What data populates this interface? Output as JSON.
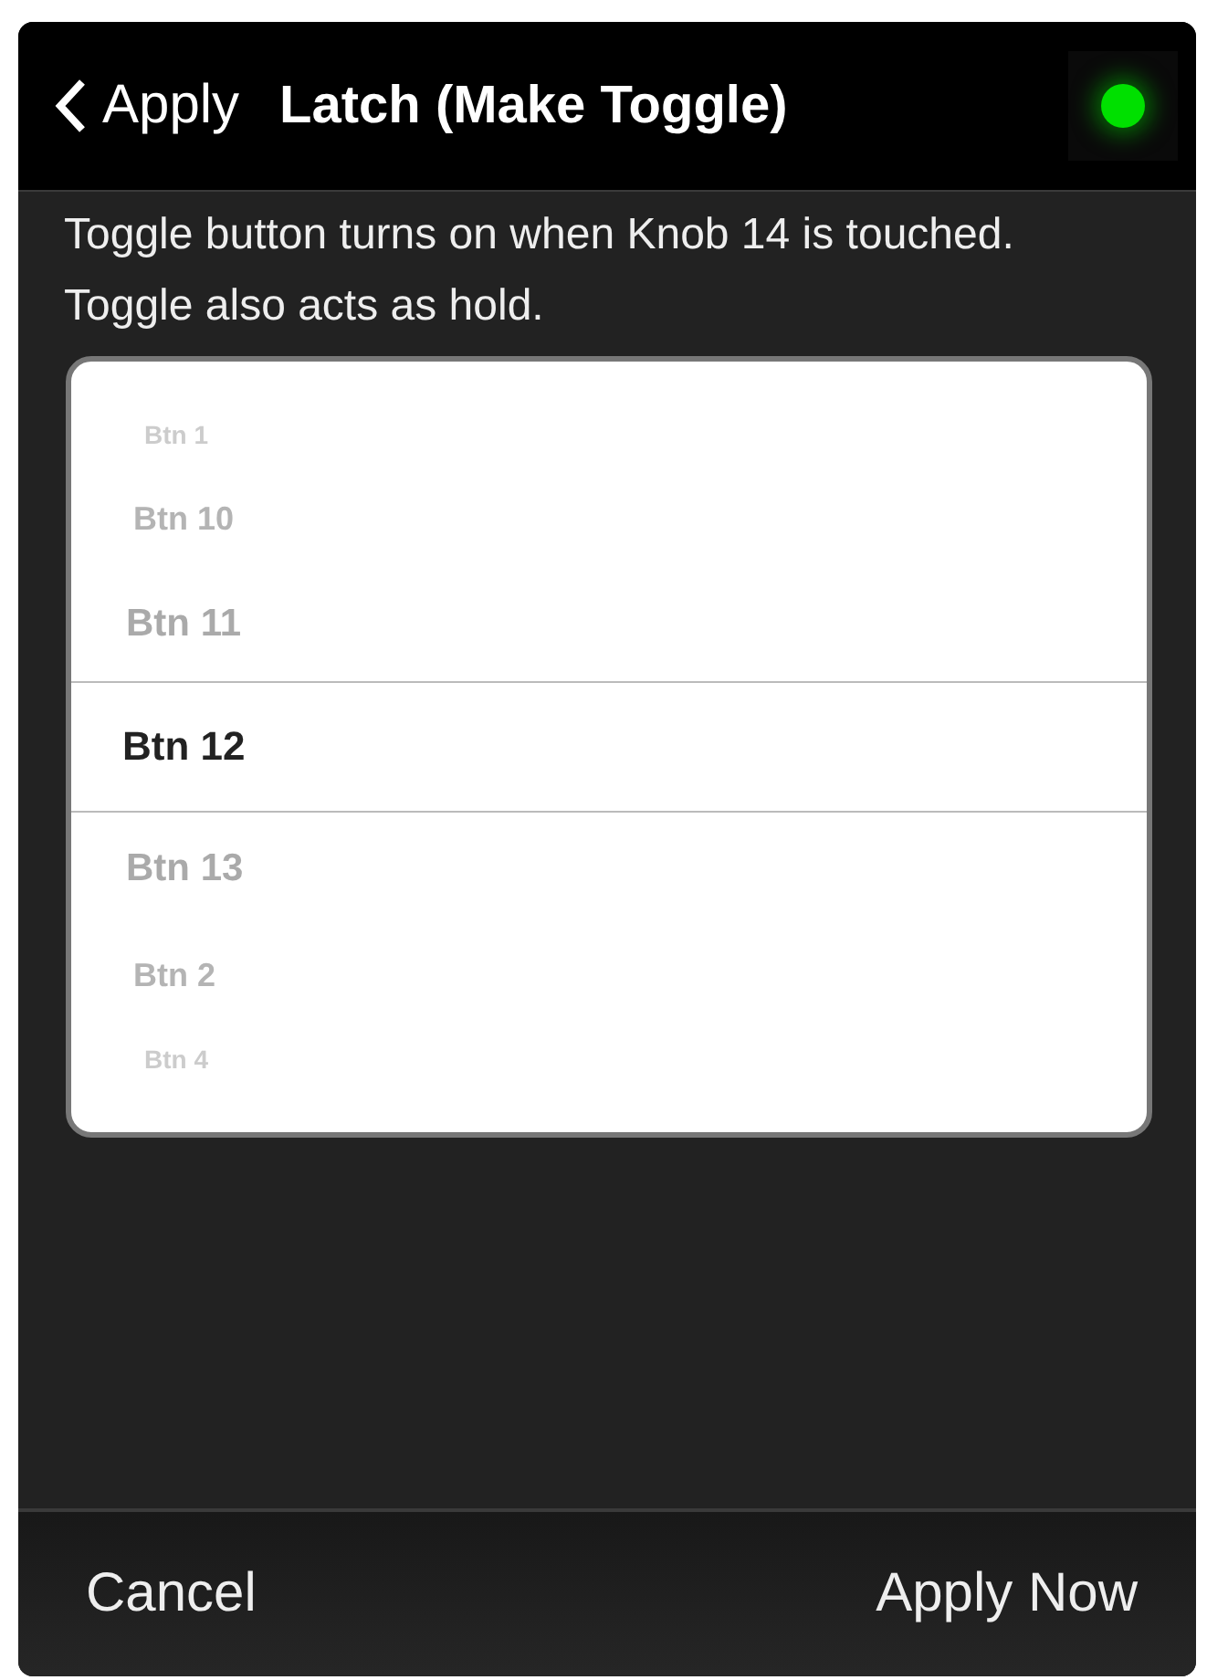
{
  "header": {
    "back_label": "Apply",
    "title": "Latch (Make Toggle)",
    "indicator_on": true
  },
  "description": [
    "Toggle button turns on when Knob 14 is touched.",
    "Toggle also acts as hold."
  ],
  "picker": {
    "items": [
      {
        "label": "Btn 1",
        "selected": false
      },
      {
        "label": "Btn 10",
        "selected": false
      },
      {
        "label": "Btn 11",
        "selected": false
      },
      {
        "label": "Btn 12",
        "selected": true
      },
      {
        "label": "Btn 13",
        "selected": false
      },
      {
        "label": "Btn 2",
        "selected": false
      },
      {
        "label": "Btn 4",
        "selected": false
      }
    ]
  },
  "footer": {
    "cancel": "Cancel",
    "apply": "Apply Now"
  }
}
